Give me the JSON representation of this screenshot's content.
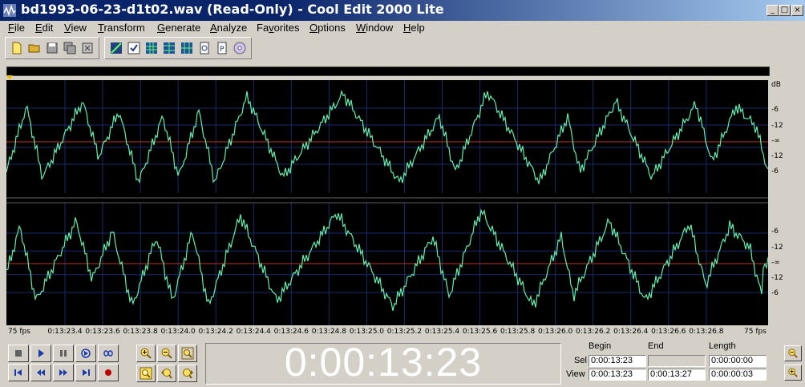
{
  "window": {
    "title": "bd1993-06-23-d1t02.wav (Read-Only) - Cool Edit 2000 Lite",
    "min_glyph": "_",
    "max_glyph": "□",
    "close_glyph": "×"
  },
  "menu": [
    {
      "key": "File",
      "u": "F",
      "rest": "ile"
    },
    {
      "key": "Edit",
      "u": "E",
      "rest": "dit"
    },
    {
      "key": "View",
      "u": "V",
      "rest": "iew"
    },
    {
      "key": "Transform",
      "u": "T",
      "rest": "ransform"
    },
    {
      "key": "Generate",
      "u": "G",
      "rest": "enerate"
    },
    {
      "key": "Analyze",
      "u": "A",
      "rest": "nalyze"
    },
    {
      "key": "Favorites",
      "pre": "Fa",
      "u": "v",
      "rest": "orites"
    },
    {
      "key": "Options",
      "u": "O",
      "rest": "ptions"
    },
    {
      "key": "Window",
      "u": "W",
      "rest": "indow"
    },
    {
      "key": "Help",
      "u": "H",
      "rest": "elp"
    }
  ],
  "toolbar": {
    "file_group": [
      "new-file-icon",
      "open-folder-icon",
      "save-icon",
      "save-all-icon",
      "close-file-icon"
    ],
    "tools_group": [
      "waveform-toggle-icon",
      "checkmark-icon",
      "grid-view-icon",
      "grid-view-alt-icon",
      "split-view-icon",
      "page-icon",
      "text-page-icon",
      "cd-icon"
    ]
  },
  "db_scale": {
    "top_unit": "dB",
    "ch1_labels": [
      "-6",
      "-12",
      "-∞",
      "-12",
      "-6"
    ],
    "ch2_labels": [
      "-6",
      "-12",
      "-∞",
      "-12",
      "-6"
    ]
  },
  "timeline": {
    "start_label": "75 fps",
    "end_label": "75 fps",
    "ticks": [
      "0:13:23.4",
      "0:13:23.6",
      "0:13:23.8",
      "0:13:24.0",
      "0:13:24.2",
      "0:13:24.4",
      "0:13:24.6",
      "0:13:24.8",
      "0:13:25.0",
      "0:13:25.2",
      "0:13:25.4",
      "0:13:25.6",
      "0:13:25.8",
      "0:13:26.0",
      "0:13:26.2",
      "0:13:26.4",
      "0:13:26.6",
      "0:13:26.8"
    ]
  },
  "transport": [
    "stop-icon",
    "play-icon",
    "pause-icon",
    "play-to-end-icon",
    "loop-icon",
    "go-to-start-icon",
    "rewind-icon",
    "fast-forward-icon",
    "go-to-end-icon",
    "record-icon"
  ],
  "zoom": [
    "zoom-in-icon",
    "zoom-out-icon",
    "zoom-full-icon",
    "zoom-selection-icon",
    "zoom-left-icon",
    "zoom-right-icon"
  ],
  "time_display": "0:00:13:23",
  "selection": {
    "headers": {
      "begin": "Begin",
      "end": "End",
      "length": "Length"
    },
    "sel_label": "Sel",
    "view_label": "View",
    "sel": {
      "begin": "0:00:13:23",
      "end": "",
      "length": "0:00:00:00"
    },
    "view": {
      "begin": "0:00:13:23",
      "end": "0:00:13:27",
      "length": "0:00:00:03"
    }
  },
  "colors": {
    "waveform": "#5ff0b0",
    "center_line": "#c03020",
    "grid": "#1a2a6a",
    "background": "#000000"
  }
}
